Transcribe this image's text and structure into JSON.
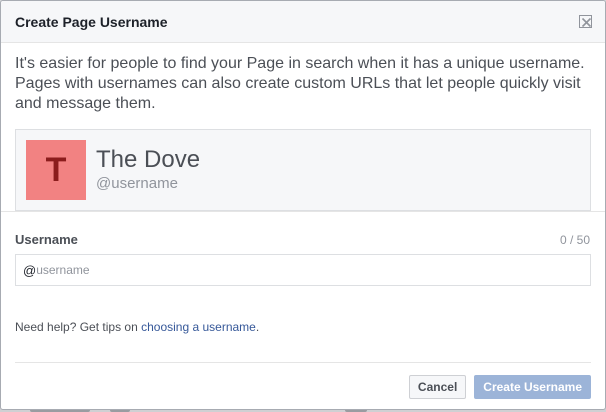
{
  "dialog": {
    "title": "Create Page Username",
    "intro": "It's easier for people to find your Page in search when it has a unique username. Pages with usernames can also create custom URLs that let people quickly visit and message them.",
    "close_icon": "close-icon"
  },
  "card": {
    "avatar_letter": "T",
    "avatar_color": "#f28282",
    "page_name": "The Dove",
    "username": "@username"
  },
  "field": {
    "label": "Username",
    "count": "0 / 50",
    "prefix": "@",
    "placeholder": "username",
    "value": ""
  },
  "help": {
    "prefix": "Need help? Get tips on ",
    "link": "choosing a username",
    "suffix": "."
  },
  "footer": {
    "cancel_label": "Cancel",
    "create_label": "Create Username"
  },
  "colors": {
    "link": "#365899",
    "primary_disabled": "#9cb4d8"
  }
}
